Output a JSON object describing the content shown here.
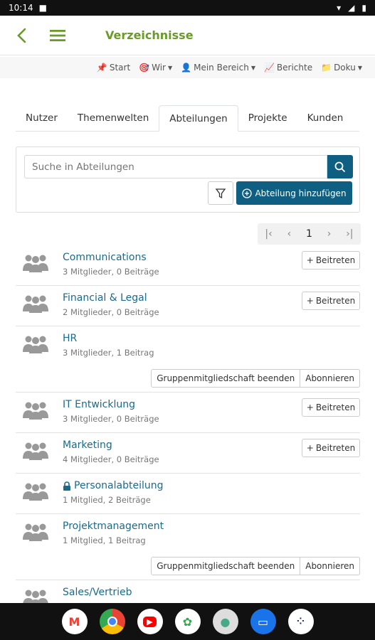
{
  "status": {
    "time": "10:14"
  },
  "appbar": {
    "title": "Verzeichnisse"
  },
  "topnav": [
    {
      "label": "Start",
      "icon": "pin-icon",
      "dropdown": false
    },
    {
      "label": "Wir",
      "icon": "target-icon",
      "dropdown": true
    },
    {
      "label": "Mein Bereich",
      "icon": "person-icon",
      "dropdown": true
    },
    {
      "label": "Berichte",
      "icon": "chart-icon",
      "dropdown": false
    },
    {
      "label": "Doku",
      "icon": "folder-icon",
      "dropdown": true
    }
  ],
  "tabs": [
    "Nutzer",
    "Themenwelten",
    "Abteilungen",
    "Projekte",
    "Kunden"
  ],
  "active_tab": "Abteilungen",
  "search": {
    "placeholder": "Suche in Abteilungen",
    "add_label": "Abteilung hinzufügen"
  },
  "pager": {
    "current": "1"
  },
  "departments": [
    {
      "name": "Communications",
      "meta": "3 Mitglieder, 0 Beiträge",
      "join": "Beitreten",
      "locked": false
    },
    {
      "name": "Financial & Legal",
      "meta": "2 Mitglieder, 0 Beiträge",
      "join": "Beitreten",
      "locked": false
    },
    {
      "name": "HR",
      "meta": "3 Mitglieder, 1 Beitrag",
      "leave": "Gruppenmitgliedschaft beenden",
      "subscribe": "Abonnieren",
      "locked": false
    },
    {
      "name": "IT Entwicklung",
      "meta": "3 Mitglieder, 0 Beiträge",
      "join": "Beitreten",
      "locked": false
    },
    {
      "name": "Marketing",
      "meta": "4 Mitglieder, 0 Beiträge",
      "join": "Beitreten",
      "locked": false
    },
    {
      "name": "Personalabteilung",
      "meta": "1 Mitglied, 2 Beiträge",
      "locked": true
    },
    {
      "name": "Projektmanagement",
      "meta": "1 Mitglied, 1 Beitrag",
      "leave": "Gruppenmitgliedschaft beenden",
      "subscribe": "Abonnieren",
      "locked": false
    },
    {
      "name": "Sales/Vertrieb",
      "meta": "",
      "locked": false
    }
  ],
  "colors": {
    "accent": "#0e5f82",
    "title_green": "#6a9a2b",
    "link": "#1a6a8c"
  },
  "dock": [
    "gmail-icon",
    "chrome-icon",
    "youtube-icon",
    "photos-icon",
    "app-icon",
    "messages-icon",
    "apps-grid-icon"
  ]
}
